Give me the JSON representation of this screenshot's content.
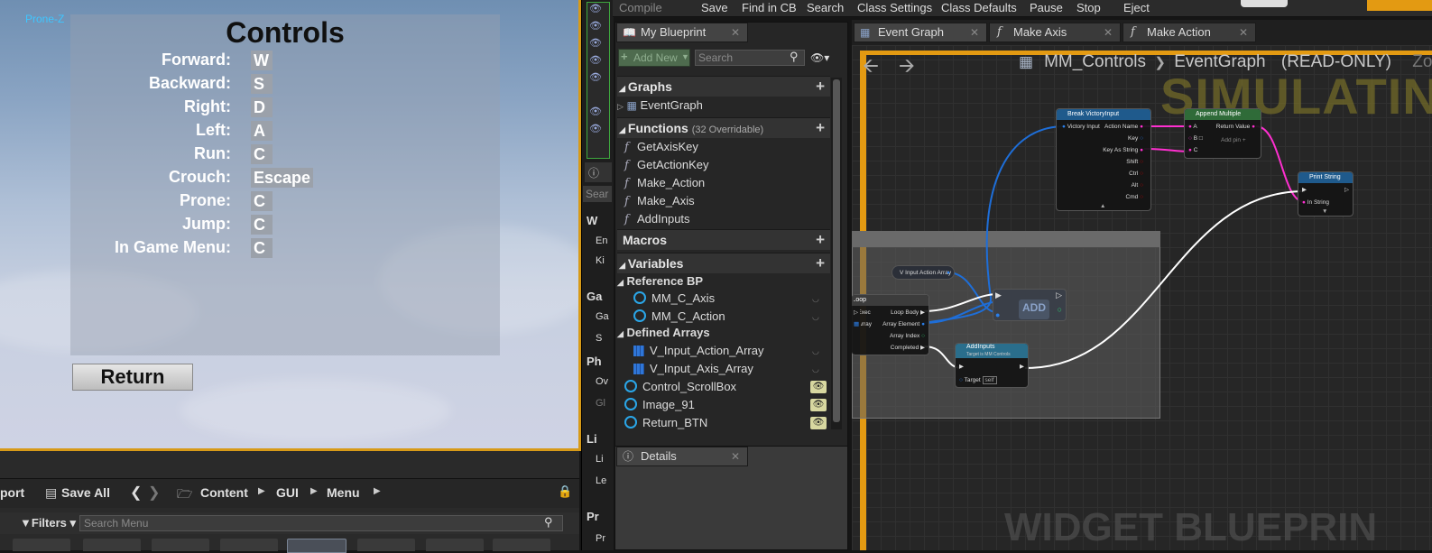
{
  "viewport": {
    "debug_label": "Prone-Z",
    "title": "Controls",
    "controls": [
      {
        "label": "Forward:",
        "key": "W"
      },
      {
        "label": "Backward:",
        "key": "S"
      },
      {
        "label": "Right:",
        "key": "D"
      },
      {
        "label": "Left:",
        "key": "A"
      },
      {
        "label": "Run:",
        "key": "C"
      },
      {
        "label": "Crouch:",
        "key": "Escape"
      },
      {
        "label": "Prone:",
        "key": "C"
      },
      {
        "label": "Jump:",
        "key": "C"
      },
      {
        "label": "In Game Menu:",
        "key": "C"
      }
    ],
    "return_label": "Return"
  },
  "content_browser": {
    "import_label": "port",
    "save_all_label": "Save All",
    "path": [
      "Content",
      "GUI",
      "Menu"
    ],
    "filters_label": "Filters",
    "search_placeholder": "Search Menu"
  },
  "toolbar": {
    "items": [
      "Compile",
      "Save",
      "Find in CB",
      "Search",
      "Class Settings",
      "Class Defaults",
      "Pause",
      "Stop",
      "Eject"
    ]
  },
  "my_blueprint": {
    "tab_label": "My Blueprint",
    "add_new_label": "Add New",
    "search_placeholder": "Search",
    "sections": {
      "graphs": "Graphs",
      "functions": "Functions",
      "functions_note": "(32 Overridable)",
      "macros": "Macros",
      "variables": "Variables"
    },
    "graphs": [
      "EventGraph"
    ],
    "functions": [
      "GetAxisKey",
      "GetActionKey",
      "Make_Action",
      "Make_Axis",
      "AddInputs"
    ],
    "categories": {
      "reference_bp": "Reference BP",
      "defined_arrays": "Defined Arrays"
    },
    "reference_vars": [
      "MM_C_Axis",
      "MM_C_Action"
    ],
    "array_vars": [
      "V_Input_Action_Array",
      "V_Input_Axis_Array"
    ],
    "widget_vars": [
      "Control_ScrollBox",
      "Image_91",
      "Return_BTN"
    ]
  },
  "details": {
    "tab_label": "Details"
  },
  "side_strip": {
    "search_label": "Sear",
    "rows": [
      "W",
      "En",
      "Ki",
      "Ga",
      "Ga",
      "S",
      "Ph",
      "Ov",
      "Gl",
      "Li",
      "Li",
      "Le",
      "Pr",
      "Pr"
    ]
  },
  "graph_tabs": [
    "Event Graph",
    "Make Axis",
    "Make Action"
  ],
  "graph": {
    "breadcrumb_root": "MM_Controls",
    "breadcrumb_leaf": "EventGraph",
    "read_only": "(READ-ONLY)",
    "zoom_fragment": "Zo",
    "simulating": "SIMULATIN",
    "watermark": "WIDGET BLUEPRIN",
    "nodes": {
      "break_victory": {
        "title": "Break VictoryInput",
        "input": "Victory Input",
        "outputs": [
          "Action Name",
          "Key",
          "Key As String",
          "Shift",
          "Ctrl",
          "Alt",
          "Cmd"
        ]
      },
      "append": {
        "title": "Append Multiple",
        "inputs": [
          "A",
          "B",
          "C"
        ],
        "output": "Return Value",
        "add_pin": "Add pin"
      },
      "print": {
        "title": "Print String",
        "input": "In String"
      },
      "var_get": {
        "title": "V Input Action Array"
      },
      "foreach": {
        "title": "ForEachLoop",
        "inputs": [
          "Exec",
          "Array"
        ],
        "outputs": [
          "Loop Body",
          "Array Element",
          "Array Index",
          "Completed"
        ]
      },
      "add": {
        "title": "ADD"
      },
      "add_inputs": {
        "title": "AddInputs",
        "subtitle": "Target is MM Controls",
        "target": "Target",
        "self": "self"
      }
    }
  },
  "colors": {
    "accent_orange": "#e39a12",
    "exec_white": "#ffffff",
    "string_pink": "#ff2fd0",
    "struct_blue": "#1e6ed8",
    "link_cyan": "#3fc6ff"
  }
}
